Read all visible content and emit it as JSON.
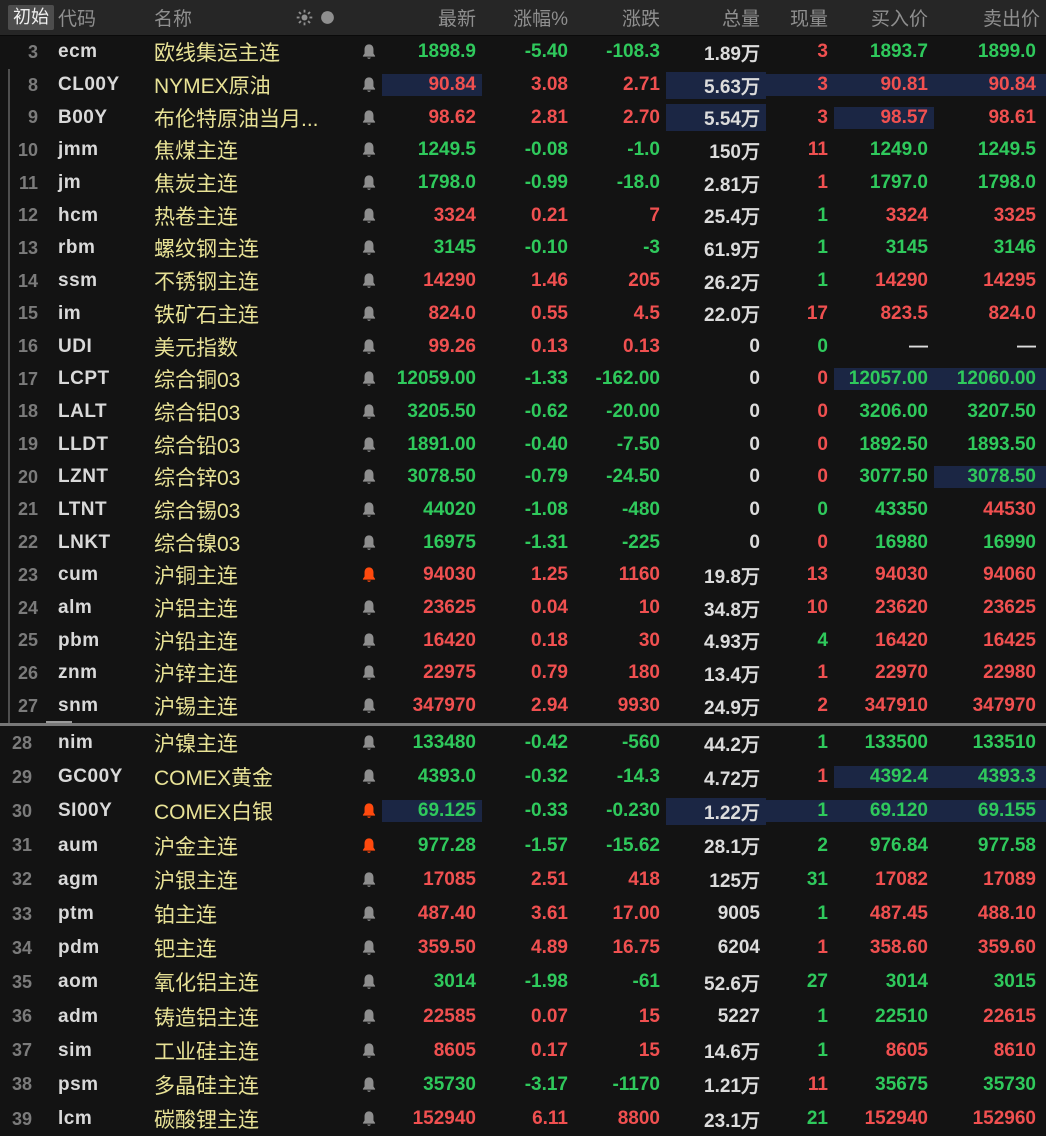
{
  "header": {
    "initial": "初始",
    "code": "代码",
    "name": "名称",
    "icons": [
      "sun-icon",
      "circle-icon"
    ],
    "last": "最新",
    "pct": "涨幅%",
    "chg": "涨跌",
    "vol": "总量",
    "cur": "现量",
    "buy": "买入价",
    "sell": "卖出价"
  },
  "colors": {
    "up_red": "#f05050",
    "down_green": "#2fc95c",
    "neutral_white": "#dcdcdc",
    "name_yellow": "#e8e296",
    "flash_highlight": "#1b2644",
    "alert_orange": "#ff4a0e",
    "header_bg": "#262626",
    "row_bg": "#131313"
  },
  "panes": [
    {
      "rows": [
        {
          "num": "3",
          "code": "ecm",
          "name": "欧线集运主连",
          "bell": "gray",
          "last": "1898.9",
          "last_c": "g",
          "pct": "-5.40",
          "pct_c": "g",
          "chg": "-108.3",
          "chg_c": "g",
          "vol": "1.89万",
          "cur": "3",
          "cur_c": "r",
          "buy": "1893.7",
          "buy_c": "g",
          "sell": "1899.0",
          "sell_c": "g",
          "hl": []
        },
        {
          "num": "8",
          "code": "CL00Y",
          "name": "NYMEX原油",
          "bell": "gray",
          "last": "90.84",
          "last_c": "r",
          "pct": "3.08",
          "pct_c": "r",
          "chg": "2.71",
          "chg_c": "r",
          "vol": "5.63万",
          "cur": "3",
          "cur_c": "r",
          "buy": "90.81",
          "buy_c": "r",
          "sell": "90.84",
          "sell_c": "r",
          "hl": [
            "last",
            "vol",
            "cur",
            "buy",
            "sell"
          ]
        },
        {
          "num": "9",
          "code": "B00Y",
          "name": "布伦特原油当月...",
          "bell": "gray",
          "last": "98.62",
          "last_c": "r",
          "pct": "2.81",
          "pct_c": "r",
          "chg": "2.70",
          "chg_c": "r",
          "vol": "5.54万",
          "cur": "3",
          "cur_c": "r",
          "buy": "98.57",
          "buy_c": "r",
          "sell": "98.61",
          "sell_c": "r",
          "hl": [
            "vol",
            "buy"
          ]
        },
        {
          "num": "10",
          "code": "jmm",
          "name": "焦煤主连",
          "bell": "gray",
          "last": "1249.5",
          "last_c": "g",
          "pct": "-0.08",
          "pct_c": "g",
          "chg": "-1.0",
          "chg_c": "g",
          "vol": "150万",
          "cur": "11",
          "cur_c": "r",
          "buy": "1249.0",
          "buy_c": "g",
          "sell": "1249.5",
          "sell_c": "g",
          "hl": []
        },
        {
          "num": "11",
          "code": "jm",
          "name": "焦炭主连",
          "bell": "gray",
          "last": "1798.0",
          "last_c": "g",
          "pct": "-0.99",
          "pct_c": "g",
          "chg": "-18.0",
          "chg_c": "g",
          "vol": "2.81万",
          "cur": "1",
          "cur_c": "r",
          "buy": "1797.0",
          "buy_c": "g",
          "sell": "1798.0",
          "sell_c": "g",
          "hl": []
        },
        {
          "num": "12",
          "code": "hcm",
          "name": "热卷主连",
          "bell": "gray",
          "last": "3324",
          "last_c": "r",
          "pct": "0.21",
          "pct_c": "r",
          "chg": "7",
          "chg_c": "r",
          "vol": "25.4万",
          "cur": "1",
          "cur_c": "g",
          "buy": "3324",
          "buy_c": "r",
          "sell": "3325",
          "sell_c": "r",
          "hl": []
        },
        {
          "num": "13",
          "code": "rbm",
          "name": "螺纹钢主连",
          "bell": "gray",
          "last": "3145",
          "last_c": "g",
          "pct": "-0.10",
          "pct_c": "g",
          "chg": "-3",
          "chg_c": "g",
          "vol": "61.9万",
          "cur": "1",
          "cur_c": "g",
          "buy": "3145",
          "buy_c": "g",
          "sell": "3146",
          "sell_c": "g",
          "hl": []
        },
        {
          "num": "14",
          "code": "ssm",
          "name": "不锈钢主连",
          "bell": "gray",
          "last": "14290",
          "last_c": "r",
          "pct": "1.46",
          "pct_c": "r",
          "chg": "205",
          "chg_c": "r",
          "vol": "26.2万",
          "cur": "1",
          "cur_c": "g",
          "buy": "14290",
          "buy_c": "r",
          "sell": "14295",
          "sell_c": "r",
          "hl": []
        },
        {
          "num": "15",
          "code": "im",
          "name": "铁矿石主连",
          "bell": "gray",
          "last": "824.0",
          "last_c": "r",
          "pct": "0.55",
          "pct_c": "r",
          "chg": "4.5",
          "chg_c": "r",
          "vol": "22.0万",
          "cur": "17",
          "cur_c": "r",
          "buy": "823.5",
          "buy_c": "r",
          "sell": "824.0",
          "sell_c": "r",
          "hl": []
        },
        {
          "num": "16",
          "code": "UDI",
          "name": "美元指数",
          "bell": "gray",
          "last": "99.26",
          "last_c": "r",
          "pct": "0.13",
          "pct_c": "r",
          "chg": "0.13",
          "chg_c": "r",
          "vol": "0",
          "cur": "0",
          "cur_c": "g",
          "buy": "—",
          "buy_c": "w",
          "sell": "—",
          "sell_c": "w",
          "hl": []
        },
        {
          "num": "17",
          "code": "LCPT",
          "name": "综合铜03",
          "bell": "gray",
          "last": "12059.00",
          "last_c": "g",
          "pct": "-1.33",
          "pct_c": "g",
          "chg": "-162.00",
          "chg_c": "g",
          "vol": "0",
          "cur": "0",
          "cur_c": "r",
          "buy": "12057.00",
          "buy_c": "g",
          "sell": "12060.00",
          "sell_c": "g",
          "hl": [
            "buy",
            "sell"
          ]
        },
        {
          "num": "18",
          "code": "LALT",
          "name": "综合铝03",
          "bell": "gray",
          "last": "3205.50",
          "last_c": "g",
          "pct": "-0.62",
          "pct_c": "g",
          "chg": "-20.00",
          "chg_c": "g",
          "vol": "0",
          "cur": "0",
          "cur_c": "r",
          "buy": "3206.00",
          "buy_c": "g",
          "sell": "3207.50",
          "sell_c": "g",
          "hl": []
        },
        {
          "num": "19",
          "code": "LLDT",
          "name": "综合铅03",
          "bell": "gray",
          "last": "1891.00",
          "last_c": "g",
          "pct": "-0.40",
          "pct_c": "g",
          "chg": "-7.50",
          "chg_c": "g",
          "vol": "0",
          "cur": "0",
          "cur_c": "r",
          "buy": "1892.50",
          "buy_c": "g",
          "sell": "1893.50",
          "sell_c": "g",
          "hl": []
        },
        {
          "num": "20",
          "code": "LZNT",
          "name": "综合锌03",
          "bell": "gray",
          "last": "3078.50",
          "last_c": "g",
          "pct": "-0.79",
          "pct_c": "g",
          "chg": "-24.50",
          "chg_c": "g",
          "vol": "0",
          "cur": "0",
          "cur_c": "r",
          "buy": "3077.50",
          "buy_c": "g",
          "sell": "3078.50",
          "sell_c": "g",
          "hl": [
            "sell"
          ]
        },
        {
          "num": "21",
          "code": "LTNT",
          "name": "综合锡03",
          "bell": "gray",
          "last": "44020",
          "last_c": "g",
          "pct": "-1.08",
          "pct_c": "g",
          "chg": "-480",
          "chg_c": "g",
          "vol": "0",
          "cur": "0",
          "cur_c": "g",
          "buy": "43350",
          "buy_c": "g",
          "sell": "44530",
          "sell_c": "r",
          "hl": []
        },
        {
          "num": "22",
          "code": "LNKT",
          "name": "综合镍03",
          "bell": "gray",
          "last": "16975",
          "last_c": "g",
          "pct": "-1.31",
          "pct_c": "g",
          "chg": "-225",
          "chg_c": "g",
          "vol": "0",
          "cur": "0",
          "cur_c": "r",
          "buy": "16980",
          "buy_c": "g",
          "sell": "16990",
          "sell_c": "g",
          "hl": []
        },
        {
          "num": "23",
          "code": "cum",
          "name": "沪铜主连",
          "bell": "orange",
          "last": "94030",
          "last_c": "r",
          "pct": "1.25",
          "pct_c": "r",
          "chg": "1160",
          "chg_c": "r",
          "vol": "19.8万",
          "cur": "13",
          "cur_c": "r",
          "buy": "94030",
          "buy_c": "r",
          "sell": "94060",
          "sell_c": "r",
          "hl": []
        },
        {
          "num": "24",
          "code": "alm",
          "name": "沪铝主连",
          "bell": "gray",
          "last": "23625",
          "last_c": "r",
          "pct": "0.04",
          "pct_c": "r",
          "chg": "10",
          "chg_c": "r",
          "vol": "34.8万",
          "cur": "10",
          "cur_c": "r",
          "buy": "23620",
          "buy_c": "r",
          "sell": "23625",
          "sell_c": "r",
          "hl": []
        },
        {
          "num": "25",
          "code": "pbm",
          "name": "沪铅主连",
          "bell": "gray",
          "last": "16420",
          "last_c": "r",
          "pct": "0.18",
          "pct_c": "r",
          "chg": "30",
          "chg_c": "r",
          "vol": "4.93万",
          "cur": "4",
          "cur_c": "g",
          "buy": "16420",
          "buy_c": "r",
          "sell": "16425",
          "sell_c": "r",
          "hl": []
        },
        {
          "num": "26",
          "code": "znm",
          "name": "沪锌主连",
          "bell": "gray",
          "last": "22975",
          "last_c": "r",
          "pct": "0.79",
          "pct_c": "r",
          "chg": "180",
          "chg_c": "r",
          "vol": "13.4万",
          "cur": "1",
          "cur_c": "r",
          "buy": "22970",
          "buy_c": "r",
          "sell": "22980",
          "sell_c": "r",
          "hl": []
        },
        {
          "num": "27",
          "code": "snm",
          "name": "沪锡主连",
          "bell": "gray",
          "last": "347970",
          "last_c": "r",
          "pct": "2.94",
          "pct_c": "r",
          "chg": "9930",
          "chg_c": "r",
          "vol": "24.9万",
          "cur": "2",
          "cur_c": "r",
          "buy": "347910",
          "buy_c": "r",
          "sell": "347970",
          "sell_c": "r",
          "hl": []
        }
      ]
    },
    {
      "rows": [
        {
          "num": "28",
          "code": "nim",
          "name": "沪镍主连",
          "bell": "gray",
          "last": "133480",
          "last_c": "g",
          "pct": "-0.42",
          "pct_c": "g",
          "chg": "-560",
          "chg_c": "g",
          "vol": "44.2万",
          "cur": "1",
          "cur_c": "g",
          "buy": "133500",
          "buy_c": "g",
          "sell": "133510",
          "sell_c": "g",
          "hl": []
        },
        {
          "num": "29",
          "code": "GC00Y",
          "name": "COMEX黄金",
          "bell": "gray",
          "last": "4393.0",
          "last_c": "g",
          "pct": "-0.32",
          "pct_c": "g",
          "chg": "-14.3",
          "chg_c": "g",
          "vol": "4.72万",
          "cur": "1",
          "cur_c": "r",
          "buy": "4392.4",
          "buy_c": "g",
          "sell": "4393.3",
          "sell_c": "g",
          "hl": [
            "buy",
            "sell"
          ]
        },
        {
          "num": "30",
          "code": "SI00Y",
          "name": "COMEX白银",
          "bell": "orange",
          "last": "69.125",
          "last_c": "g",
          "pct": "-0.33",
          "pct_c": "g",
          "chg": "-0.230",
          "chg_c": "g",
          "vol": "1.22万",
          "cur": "1",
          "cur_c": "g",
          "buy": "69.120",
          "buy_c": "g",
          "sell": "69.155",
          "sell_c": "g",
          "hl": [
            "last",
            "vol",
            "cur",
            "buy",
            "sell"
          ]
        },
        {
          "num": "31",
          "code": "aum",
          "name": "沪金主连",
          "bell": "orange",
          "last": "977.28",
          "last_c": "g",
          "pct": "-1.57",
          "pct_c": "g",
          "chg": "-15.62",
          "chg_c": "g",
          "vol": "28.1万",
          "cur": "2",
          "cur_c": "g",
          "buy": "976.84",
          "buy_c": "g",
          "sell": "977.58",
          "sell_c": "g",
          "hl": []
        },
        {
          "num": "32",
          "code": "agm",
          "name": "沪银主连",
          "bell": "gray",
          "last": "17085",
          "last_c": "r",
          "pct": "2.51",
          "pct_c": "r",
          "chg": "418",
          "chg_c": "r",
          "vol": "125万",
          "cur": "31",
          "cur_c": "g",
          "buy": "17082",
          "buy_c": "r",
          "sell": "17089",
          "sell_c": "r",
          "hl": []
        },
        {
          "num": "33",
          "code": "ptm",
          "name": "铂主连",
          "bell": "gray",
          "last": "487.40",
          "last_c": "r",
          "pct": "3.61",
          "pct_c": "r",
          "chg": "17.00",
          "chg_c": "r",
          "vol": "9005",
          "cur": "1",
          "cur_c": "g",
          "buy": "487.45",
          "buy_c": "r",
          "sell": "488.10",
          "sell_c": "r",
          "hl": []
        },
        {
          "num": "34",
          "code": "pdm",
          "name": "钯主连",
          "bell": "gray",
          "last": "359.50",
          "last_c": "r",
          "pct": "4.89",
          "pct_c": "r",
          "chg": "16.75",
          "chg_c": "r",
          "vol": "6204",
          "cur": "1",
          "cur_c": "r",
          "buy": "358.60",
          "buy_c": "r",
          "sell": "359.60",
          "sell_c": "r",
          "hl": []
        },
        {
          "num": "35",
          "code": "aom",
          "name": "氧化铝主连",
          "bell": "gray",
          "last": "3014",
          "last_c": "g",
          "pct": "-1.98",
          "pct_c": "g",
          "chg": "-61",
          "chg_c": "g",
          "vol": "52.6万",
          "cur": "27",
          "cur_c": "g",
          "buy": "3014",
          "buy_c": "g",
          "sell": "3015",
          "sell_c": "g",
          "hl": []
        },
        {
          "num": "36",
          "code": "adm",
          "name": "铸造铝主连",
          "bell": "gray",
          "last": "22585",
          "last_c": "r",
          "pct": "0.07",
          "pct_c": "r",
          "chg": "15",
          "chg_c": "r",
          "vol": "5227",
          "cur": "1",
          "cur_c": "g",
          "buy": "22510",
          "buy_c": "g",
          "sell": "22615",
          "sell_c": "r",
          "hl": []
        },
        {
          "num": "37",
          "code": "sim",
          "name": "工业硅主连",
          "bell": "gray",
          "last": "8605",
          "last_c": "r",
          "pct": "0.17",
          "pct_c": "r",
          "chg": "15",
          "chg_c": "r",
          "vol": "14.6万",
          "cur": "1",
          "cur_c": "g",
          "buy": "8605",
          "buy_c": "r",
          "sell": "8610",
          "sell_c": "r",
          "hl": []
        },
        {
          "num": "38",
          "code": "psm",
          "name": "多晶硅主连",
          "bell": "gray",
          "last": "35730",
          "last_c": "g",
          "pct": "-3.17",
          "pct_c": "g",
          "chg": "-1170",
          "chg_c": "g",
          "vol": "1.21万",
          "cur": "11",
          "cur_c": "r",
          "buy": "35675",
          "buy_c": "g",
          "sell": "35730",
          "sell_c": "g",
          "hl": []
        },
        {
          "num": "39",
          "code": "lcm",
          "name": "碳酸锂主连",
          "bell": "gray",
          "last": "152940",
          "last_c": "r",
          "pct": "6.11",
          "pct_c": "r",
          "chg": "8800",
          "chg_c": "r",
          "vol": "23.1万",
          "cur": "21",
          "cur_c": "g",
          "buy": "152940",
          "buy_c": "r",
          "sell": "152960",
          "sell_c": "r",
          "hl": []
        }
      ]
    }
  ]
}
